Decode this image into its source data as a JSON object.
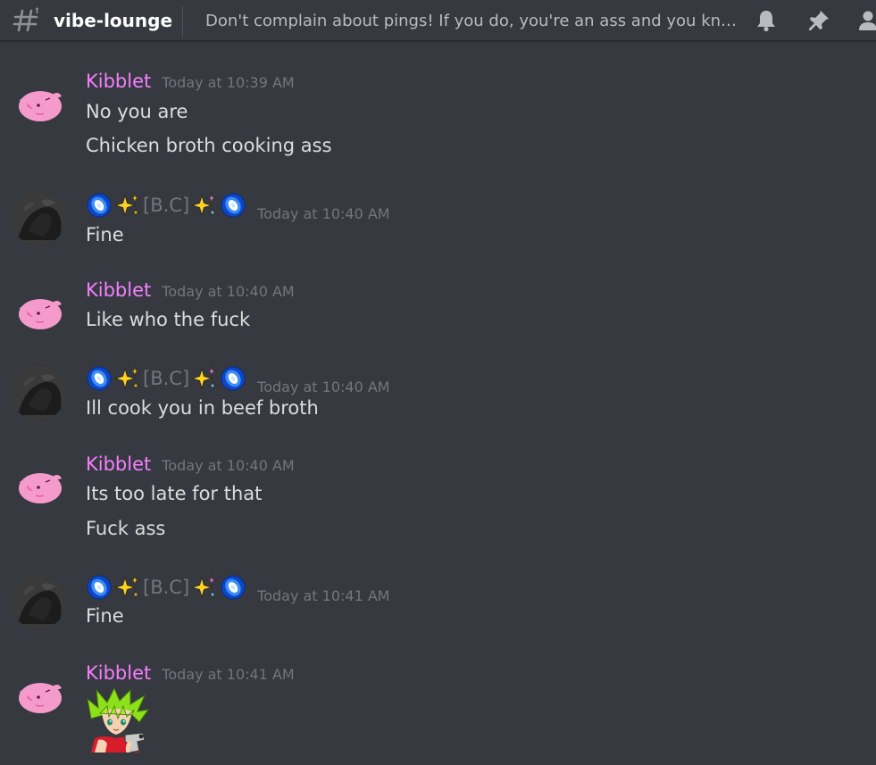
{
  "header": {
    "channel_icon": "hashtag-icon",
    "channel_name": "vibe-lounge",
    "topic": "Don't complain about pings! If you do, you're an ass and you know it.",
    "icons": [
      "bell-icon",
      "pin-icon",
      "members-icon"
    ]
  },
  "colors": {
    "background": "#36393f",
    "kibblet_name": "#f47fff",
    "muted_text": "#72767d",
    "message_text": "#dcddde"
  },
  "users": {
    "kibblet": "Kibblet",
    "bc": "[B.C]"
  },
  "messages": [
    {
      "author": "Kibblet",
      "timestamp": "Today at 10:39 AM",
      "lines": [
        "No you are",
        "Chicken broth cooking ass"
      ]
    },
    {
      "author": "[B.C]",
      "timestamp": "Today at 10:40 AM",
      "lines": [
        "Fine"
      ]
    },
    {
      "author": "Kibblet",
      "timestamp": "Today at 10:40 AM",
      "lines": [
        "Like who the fuck"
      ]
    },
    {
      "author": "[B.C]",
      "timestamp": "Today at 10:40 AM",
      "lines": [
        "Ill cook you in beef broth"
      ]
    },
    {
      "author": "Kibblet",
      "timestamp": "Today at 10:40 AM",
      "lines": [
        "Its too late for that",
        "Fuck ass"
      ]
    },
    {
      "author": "[B.C]",
      "timestamp": "Today at 10:41 AM",
      "lines": [
        "Fine"
      ]
    },
    {
      "author": "Kibblet",
      "timestamp": "Today at 10:41 AM",
      "lines": [],
      "attachment": "anime-girl-gun-sticker"
    }
  ]
}
